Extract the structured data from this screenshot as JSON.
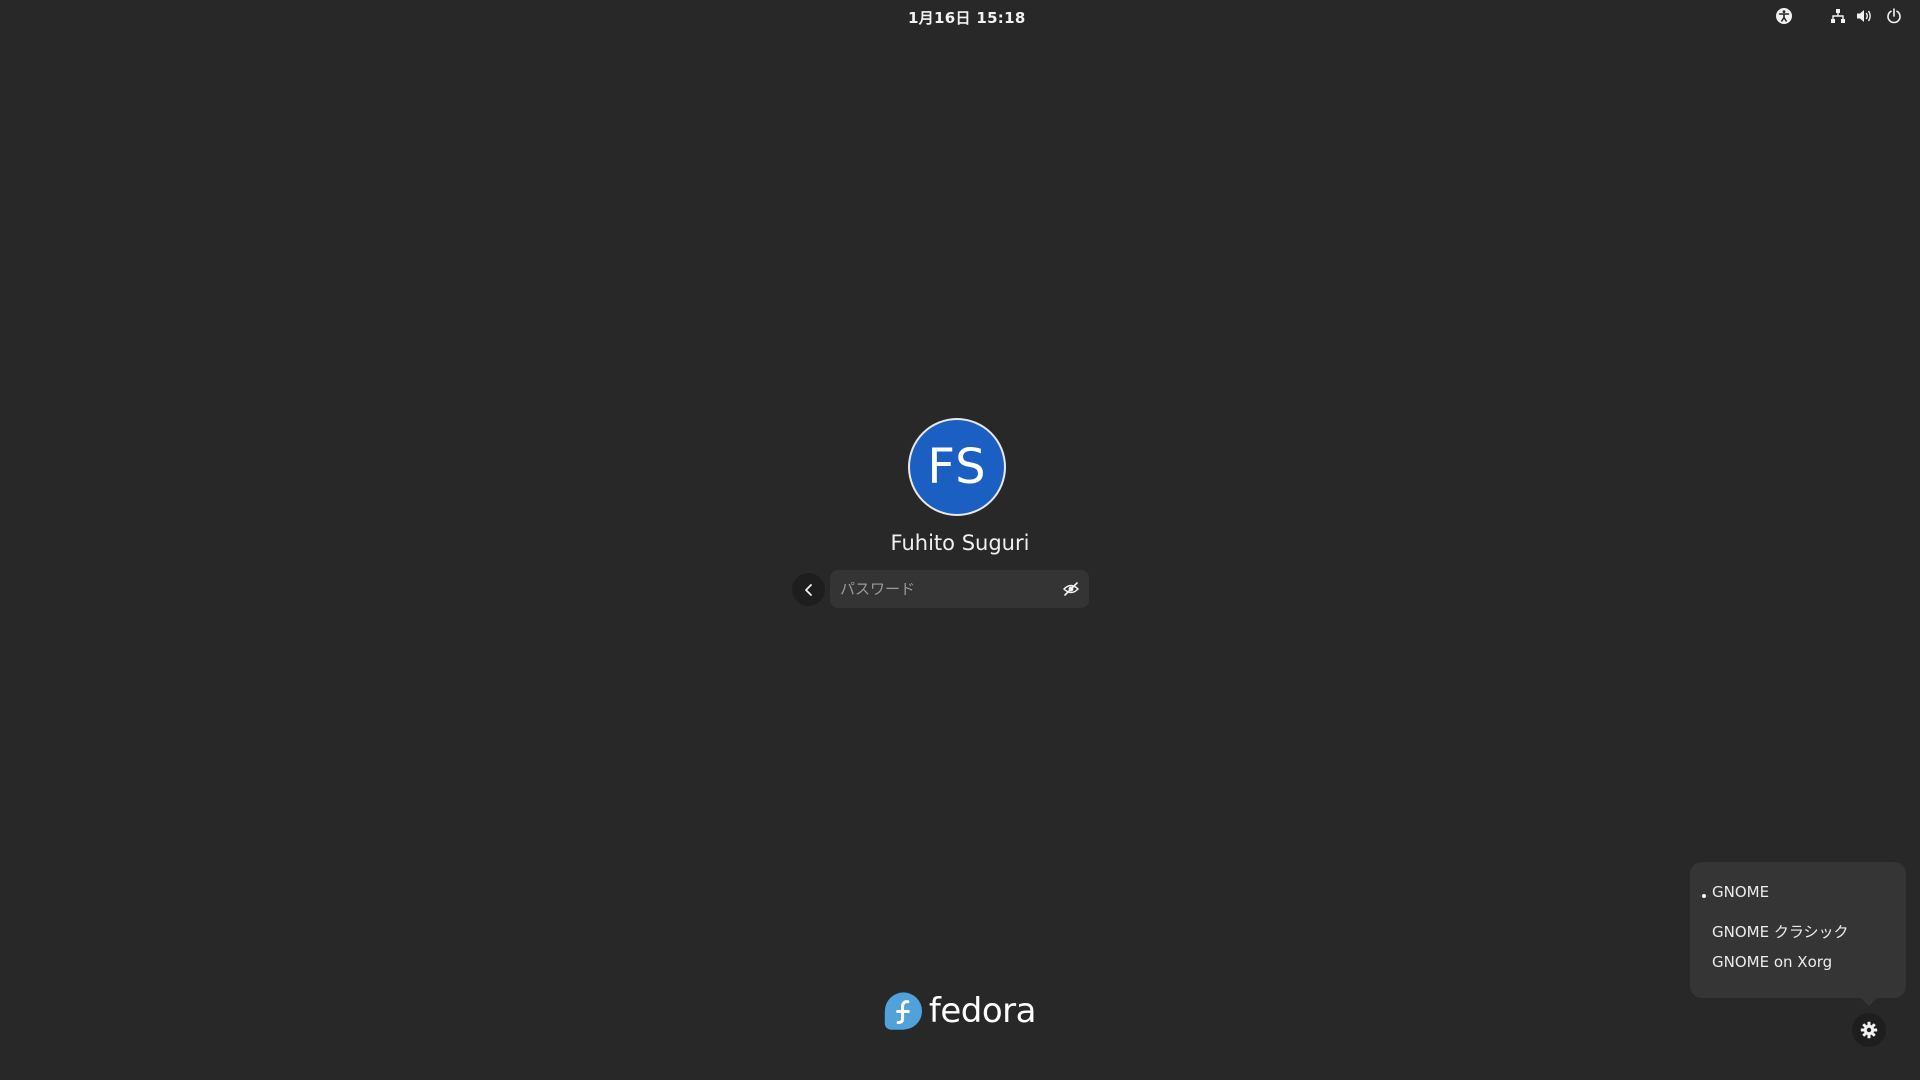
{
  "topbar": {
    "clock": "1月16日 15:18",
    "icons": [
      "accessibility-icon",
      "network-wired-icon",
      "volume-icon",
      "power-icon"
    ]
  },
  "login": {
    "avatar_initials": "FS",
    "avatar_color": "#1c5fc3",
    "username": "Fuhito Suguri",
    "password_placeholder": "パスワード",
    "password_value": ""
  },
  "branding": {
    "logo_text": "fedora",
    "logo_color": "#51a2da"
  },
  "session_menu": {
    "items": [
      {
        "label": "GNOME",
        "selected": true
      },
      {
        "label": "GNOME クラシック",
        "selected": false
      },
      {
        "label": "GNOME on Xorg",
        "selected": false
      }
    ]
  }
}
